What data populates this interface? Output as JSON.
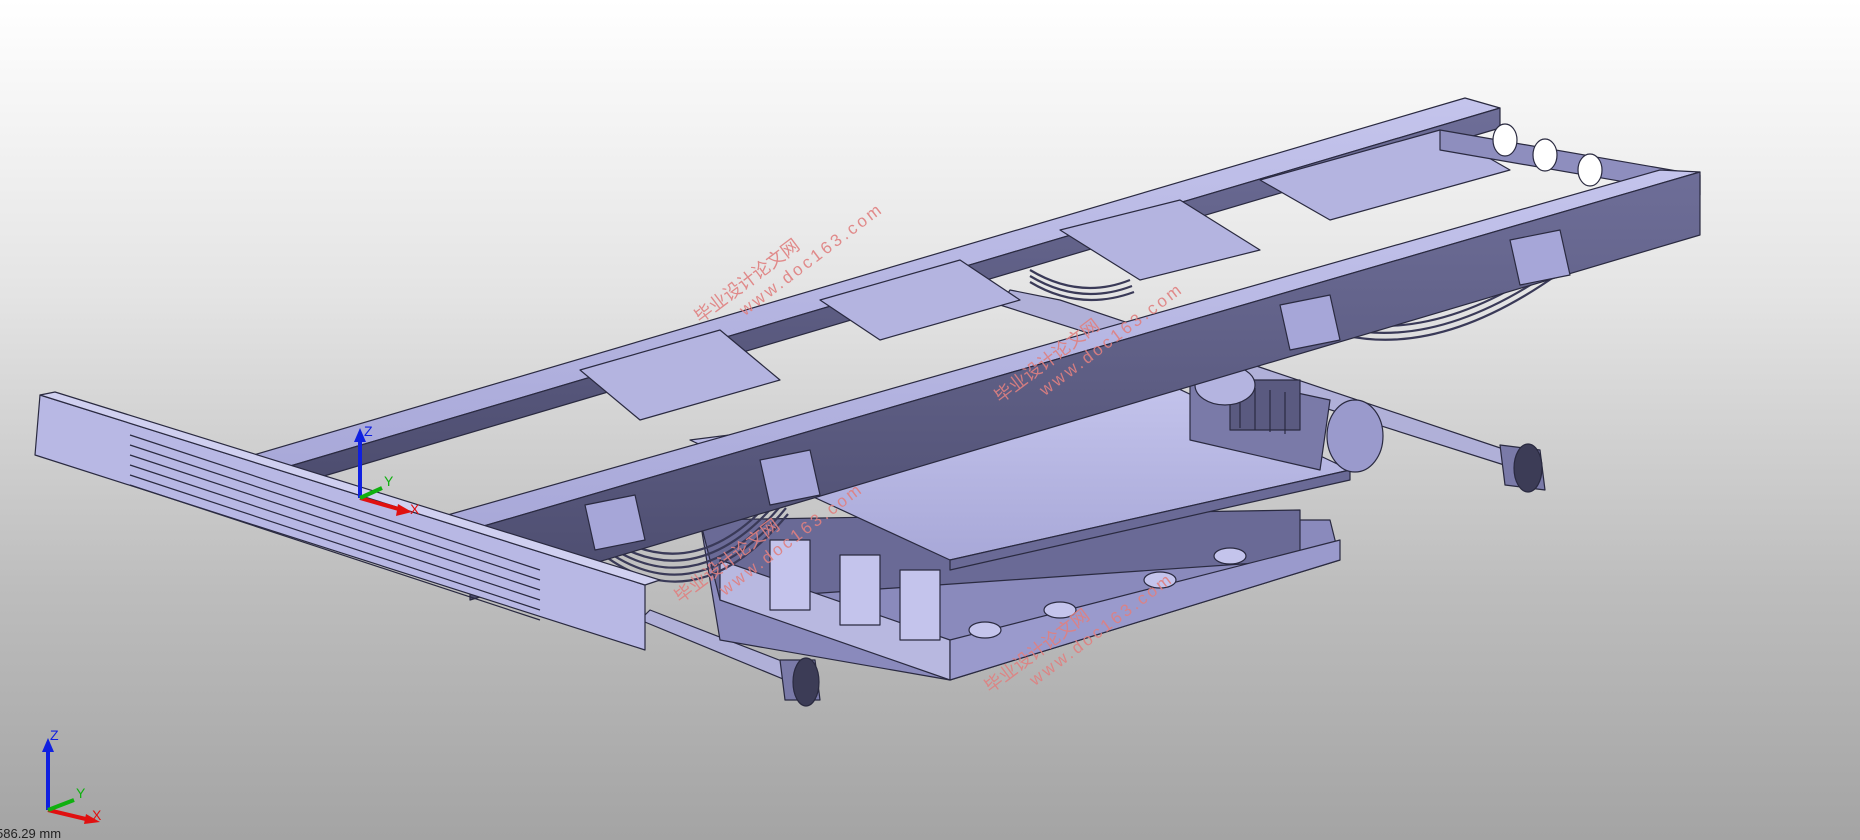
{
  "viewport": {
    "background_top": "#ffffff",
    "background_bottom": "#a4a4a4",
    "model_color": "#a6a6d8",
    "edge_color": "#2a2a40"
  },
  "watermarks": [
    {
      "cn": "毕业设计论文网",
      "url": "www.doc163.com"
    },
    {
      "cn": "毕业设计论文网",
      "url": "www.doc163.com"
    },
    {
      "cn": "毕业设计论文网",
      "url": "www.doc163.com"
    },
    {
      "cn": "毕业设计论文网",
      "url": "www.doc163.com"
    }
  ],
  "model_triad": {
    "x": "X",
    "y": "Y",
    "z": "Z"
  },
  "corner_triad": {
    "x": "X",
    "y": "Y",
    "z": "Z"
  },
  "scale_readout": "586.29 mm",
  "colors": {
    "x_axis": "#e01010",
    "y_axis": "#10b010",
    "z_axis": "#1020e0",
    "watermark": "#e08080"
  },
  "icons": [
    "axis-triad-icon"
  ]
}
